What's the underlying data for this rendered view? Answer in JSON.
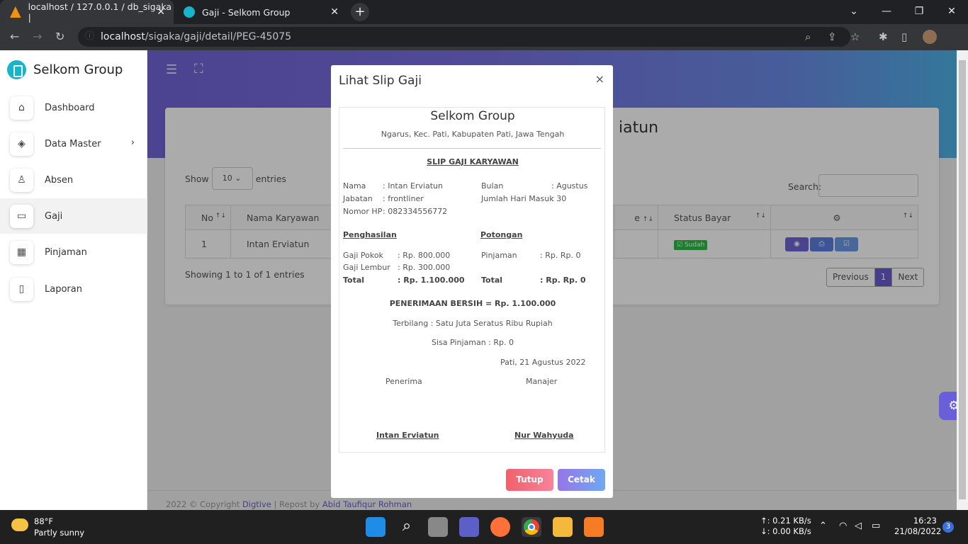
{
  "browser": {
    "tabs": [
      {
        "title": "localhost / 127.0.0.1 / db_sigaka | "
      },
      {
        "title": "Gaji - Selkom Group"
      }
    ],
    "url_host": "localhost",
    "url_path": "/sigaka/gaji/detail/PEG-45075"
  },
  "sidebar": {
    "brand": "Selkom Group",
    "items": [
      {
        "label": "Dashboard",
        "icon": "home-icon"
      },
      {
        "label": "Data Master",
        "icon": "layers-icon"
      },
      {
        "label": "Absen",
        "icon": "user-check-icon"
      },
      {
        "label": "Gaji",
        "icon": "folder-icon"
      },
      {
        "label": "Pinjaman",
        "icon": "calendar-icon"
      },
      {
        "label": "Laporan",
        "icon": "file-icon"
      }
    ]
  },
  "page": {
    "title_partial": "iatun",
    "show_label": "Show",
    "entries_value": "10",
    "entries_label": "entries",
    "search_label": "Search:",
    "table": {
      "headers": [
        "No",
        "Nama Karyawan",
        "e",
        "Status Bayar",
        ""
      ],
      "rows": [
        {
          "no": "1",
          "nama": "Intan Erviatun",
          "status": "Sudah"
        }
      ]
    },
    "info": "Showing 1 to 1 of 1 entries",
    "pager": {
      "prev": "Previous",
      "current": "1",
      "next": "Next"
    },
    "footer_prefix": "2022 © Copyright ",
    "footer_link1": "Digtive",
    "footer_mid": " | Repost by ",
    "footer_link2": "Abid Taufiqur Rohman"
  },
  "modal": {
    "title": "Lihat Slip Gaji",
    "close": "×",
    "company": "Selkom Group",
    "address": "Ngarus, Kec. Pati, Kabupaten Pati, Jawa Tengah",
    "slip_title": "SLIP GAJI KARYAWAN",
    "nama_label": "Nama",
    "nama_value": ": Intan Erviatun",
    "jabatan_label": "Jabatan",
    "jabatan_value": ": frontliner",
    "hp_label": "Nomor HP",
    "hp_value": ": 082334556772",
    "bulan_label": "Bulan",
    "bulan_value": ": Agustus",
    "hari_label": "Jumlah Hari Masuk",
    "hari_value": ": 30",
    "penghasilan": "Penghasilan",
    "potongan": "Potongan",
    "gaji_pokok_label": "Gaji Pokok",
    "gaji_pokok_value": ": Rp. 800.000",
    "gaji_lembur_label": "Gaji Lembur",
    "gaji_lembur_value": ": Rp. 300.000",
    "total_label": "Total",
    "total_value": ": Rp. 1.100.000",
    "pinjaman_label": "Pinjaman",
    "pinjaman_value": ": Rp. Rp. 0",
    "total_pot_label": "Total",
    "total_pot_value": ": Rp. Rp. 0",
    "bersih": "PENERIMAAN BERSIH = Rp. 1.100.000",
    "terbilang": "Terbilang : Satu Juta Seratus Ribu Rupiah",
    "sisa": "Sisa Pinjaman : Rp. 0",
    "tanggal": "Pati, 21 Agustus 2022",
    "penerima_label": "Penerima",
    "manajer_label": "Manajer",
    "penerima_name": "Intan Erviatun",
    "manajer_name": "Nur Wahyuda",
    "btn_tutup": "Tutup",
    "btn_cetak": "Cetak"
  },
  "taskbar": {
    "temp": "88°F",
    "weather": "Partly sunny",
    "up": "↑: 0.21 KB/s",
    "down": "↓: 0.00 KB/s",
    "time": "16:23",
    "date": "21/08/2022",
    "notif": "3"
  },
  "colors": {
    "accent": "#6c5ccf",
    "danger_btn": "#f0606a",
    "success": "#2dbd45"
  }
}
